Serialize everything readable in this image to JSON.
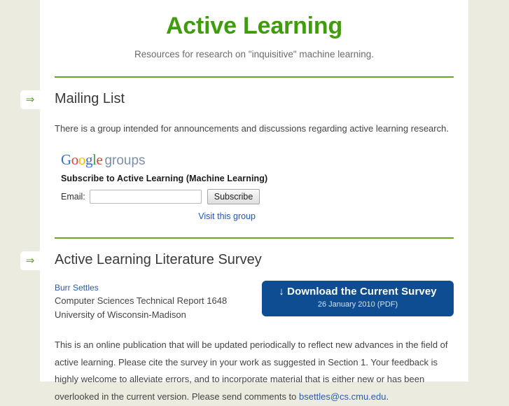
{
  "site": {
    "title": "Active Learning",
    "subtitle": "Resources for research on \"inquisitive\" machine learning.",
    "title_color": "#3f9c0a",
    "divider_color": "#6aa522",
    "page_background": "#ecebe0",
    "content_background": "#ffffff"
  },
  "gutter": {
    "arrow_glyph": "⇒",
    "arrow_color": "#59a310"
  },
  "mailing_list": {
    "heading": "Mailing List",
    "intro": "There is a group intended for announcements and discussions regarding active learning research.",
    "widget": {
      "logo": {
        "g1": "G",
        "o1": "o",
        "o2": "o",
        "g2": "g",
        "l1": "l",
        "e1": "e",
        "groups_word": "groups"
      },
      "subscribe_title": "Subscribe to Active Learning (Machine Learning)",
      "email_label": "Email:",
      "email_value": "",
      "email_placeholder": "",
      "subscribe_button": "Subscribe",
      "visit_group_link": "Visit this group"
    }
  },
  "survey": {
    "heading": "Active Learning Literature Survey",
    "author": "Burr Settles",
    "citation_line_1": "Computer Sciences Technical Report 1648",
    "citation_line_2": "University of Wisconsin-Madison",
    "download": {
      "label": "↓ Download the Current Survey",
      "sublabel": "26 January 2010 (PDF)",
      "background_color": "#0e4d91"
    },
    "description_part_1": "This is an online publication that will be updated periodically to reflect new advances in the field of active learning. Please cite the survey in your work as suggested in Section 1. Your feedback is highly welcome to alleviate errors, and to incorporate material that is either new or has been overlooked in the current version. Please send comments to ",
    "contact_email": "bsettles@cs.cmu.edu",
    "description_part_2": "."
  }
}
